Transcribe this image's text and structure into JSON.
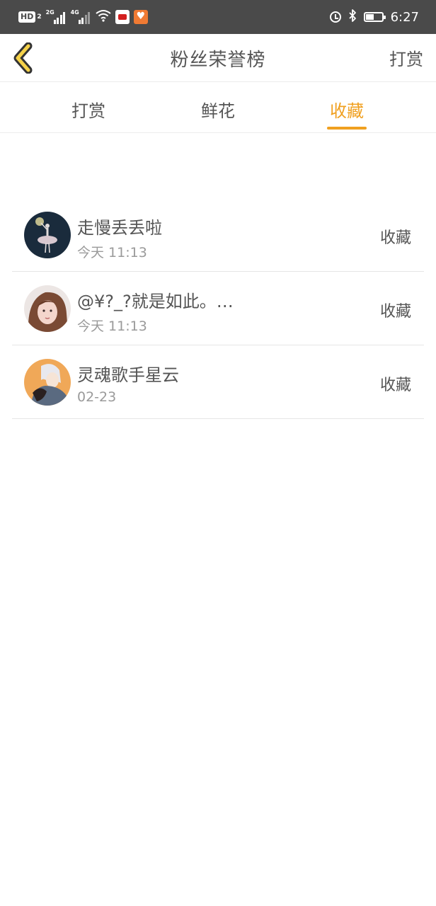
{
  "status_bar": {
    "hd_label": "HD",
    "hd_sub": "2",
    "net1": "2G",
    "net2": "4G",
    "time": "6:27"
  },
  "nav": {
    "title": "粉丝荣誉榜",
    "action": "打赏"
  },
  "tabs": [
    {
      "label": "打赏"
    },
    {
      "label": "鲜花"
    },
    {
      "label": "收藏"
    }
  ],
  "active_tab": "收藏",
  "colors": {
    "accent": "#f0a020",
    "status_bar": "#4a4a4a",
    "text": "#555555",
    "muted": "#9a9a9a"
  },
  "entries": [
    {
      "name": "走慢丢丢啦",
      "time": "今天 11:13",
      "action": "收藏",
      "avatar": "ballerina-avatar"
    },
    {
      "name": "@¥?_?就是如此。…",
      "time": "今天 11:13",
      "action": "收藏",
      "avatar": "girl-photo-avatar"
    },
    {
      "name": "灵魂歌手星云",
      "time": "02-23",
      "action": "收藏",
      "avatar": "anime-avatar"
    }
  ]
}
